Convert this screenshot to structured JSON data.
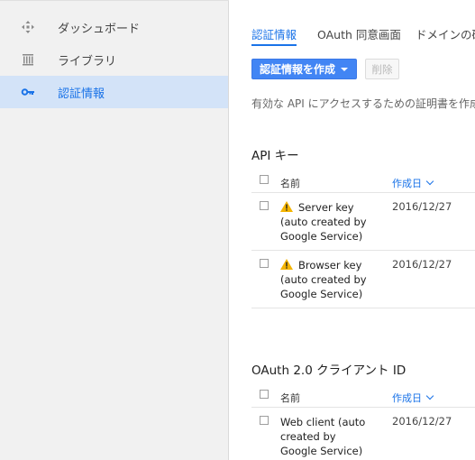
{
  "sidebar": {
    "items": [
      {
        "label": "ダッシュボード",
        "icon": "dashboard-icon"
      },
      {
        "label": "ライブラリ",
        "icon": "library-icon"
      },
      {
        "label": "認証情報",
        "icon": "key-icon",
        "active": true
      }
    ]
  },
  "tabs": [
    {
      "label": "認証情報",
      "active": true
    },
    {
      "label": "OAuth 同意画面"
    },
    {
      "label": "ドメインの確"
    }
  ],
  "toolbar": {
    "create_label": "認証情報を作成",
    "delete_label": "削除"
  },
  "description": "有効な API にアクセスするための証明書を作成",
  "api_keys": {
    "title": "API キー",
    "col_name": "名前",
    "col_date": "作成日",
    "rows": [
      {
        "name": "Server key (auto created by Google Service)",
        "date": "2016/12/27",
        "warning": true
      },
      {
        "name": "Browser key (auto created by Google Service)",
        "date": "2016/12/27",
        "warning": true
      }
    ]
  },
  "oauth": {
    "title": "OAuth 2.0 クライアント ID",
    "col_name": "名前",
    "col_date": "作成日",
    "rows": [
      {
        "name": "Web client (auto created by Google Service)",
        "date": "2016/12/27",
        "warning": false
      }
    ]
  },
  "colors": {
    "accent": "#1a73e8",
    "button": "#4285f4",
    "active_bg": "#d3e3f8",
    "warning": "#f4b400"
  }
}
